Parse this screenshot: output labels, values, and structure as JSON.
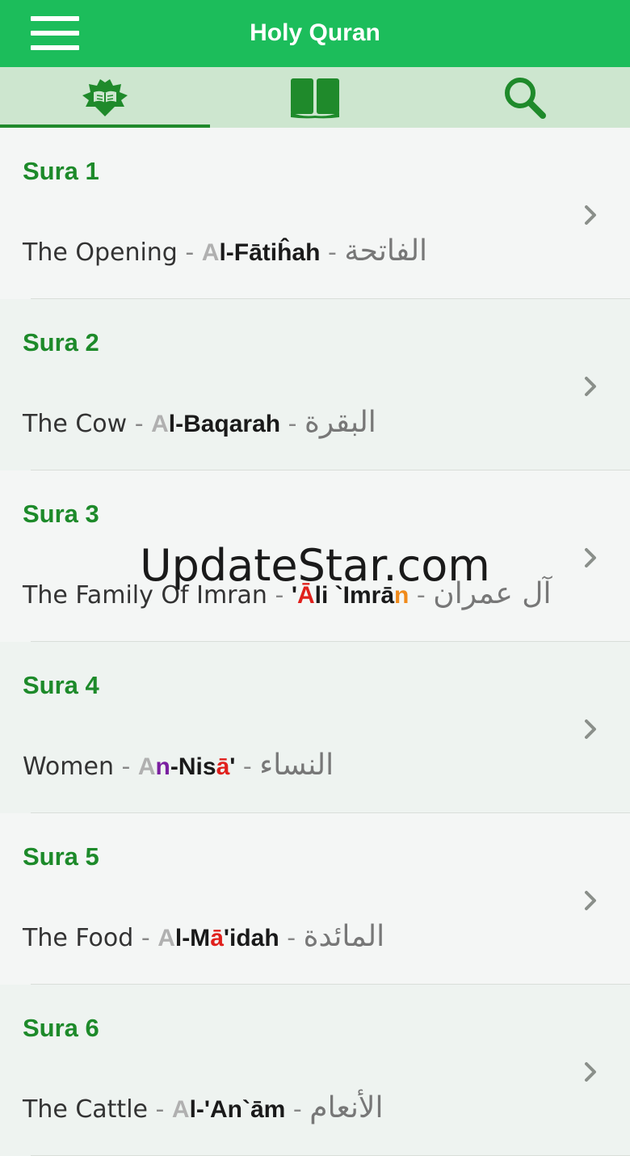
{
  "header": {
    "title": "Holy Quran"
  },
  "tabs": [
    {
      "name": "quran-reading",
      "icon": "open-book-stand-icon"
    },
    {
      "name": "book",
      "icon": "book-icon"
    },
    {
      "name": "search",
      "icon": "search-icon"
    }
  ],
  "colors": {
    "accent": "#1cbd5b",
    "sura_label": "#1d8a2a",
    "tabbar": "#cde6cf"
  },
  "suras": [
    {
      "label": "Sura 1",
      "english": "The Opening",
      "arabic": "الفاتحة",
      "translit": [
        {
          "t": "A",
          "c": "g"
        },
        {
          "t": "l-Fātiĥah",
          "c": ""
        }
      ]
    },
    {
      "label": "Sura 2",
      "english": "The Cow",
      "arabic": "البقرة",
      "translit": [
        {
          "t": "A",
          "c": "g"
        },
        {
          "t": "l-Baqarah",
          "c": ""
        }
      ]
    },
    {
      "label": "Sura 3",
      "english": "The Family Of Imran",
      "arabic": "آل عمران",
      "translit": [
        {
          "t": "'",
          "c": ""
        },
        {
          "t": "Ā",
          "c": "r"
        },
        {
          "t": "li `Imrā",
          "c": ""
        },
        {
          "t": "n",
          "c": "o"
        }
      ]
    },
    {
      "label": "Sura 4",
      "english": "Women",
      "arabic": "النساء",
      "translit": [
        {
          "t": "A",
          "c": "g"
        },
        {
          "t": "n",
          "c": "p"
        },
        {
          "t": "-Nis",
          "c": ""
        },
        {
          "t": "ā",
          "c": "r"
        },
        {
          "t": "'",
          "c": ""
        }
      ]
    },
    {
      "label": "Sura 5",
      "english": "The Food",
      "arabic": "المائدة",
      "translit": [
        {
          "t": "A",
          "c": "g"
        },
        {
          "t": "l-M",
          "c": ""
        },
        {
          "t": "ā",
          "c": "r"
        },
        {
          "t": "'idah",
          "c": ""
        }
      ]
    },
    {
      "label": "Sura 6",
      "english": "The Cattle",
      "arabic": "الأنعام",
      "translit": [
        {
          "t": "A",
          "c": "g"
        },
        {
          "t": "l-'An`ām",
          "c": ""
        }
      ]
    }
  ],
  "separator": "-",
  "watermark": "UpdateStar.com"
}
